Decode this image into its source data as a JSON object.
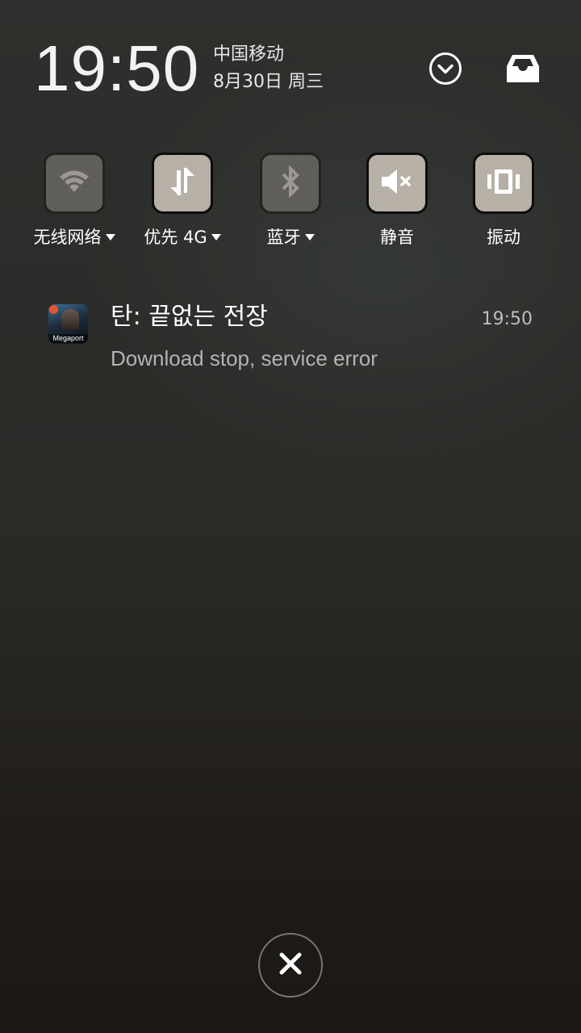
{
  "header": {
    "time": "19:50",
    "carrier": "中国移动",
    "date": "8月30日 周三",
    "expand_icon": "chevron-down-circle-icon",
    "inbox_icon": "inbox-tray-icon"
  },
  "quick_settings": [
    {
      "key": "wifi",
      "label": "无线网络",
      "icon": "wifi-icon",
      "state": "off",
      "has_dropdown": true
    },
    {
      "key": "data",
      "label": "优先 4G",
      "icon": "mobile-data-icon",
      "state": "on",
      "has_dropdown": true
    },
    {
      "key": "bluetooth",
      "label": "蓝牙",
      "icon": "bluetooth-icon",
      "state": "off",
      "has_dropdown": true
    },
    {
      "key": "mute",
      "label": "静音",
      "icon": "mute-icon",
      "state": "on",
      "has_dropdown": false
    },
    {
      "key": "vibrate",
      "label": "振动",
      "icon": "vibrate-icon",
      "state": "on",
      "has_dropdown": false
    }
  ],
  "notification": {
    "app_icon_text": "Megaport",
    "title": "탄: 끝없는 전장",
    "time": "19:50",
    "body": "Download stop, service error"
  },
  "clear_button": {
    "icon": "close-icon"
  },
  "colors": {
    "tile_on": "#b5aea4",
    "tile_off": "#5e5c57",
    "secondary_text": "#b3b3b3"
  }
}
